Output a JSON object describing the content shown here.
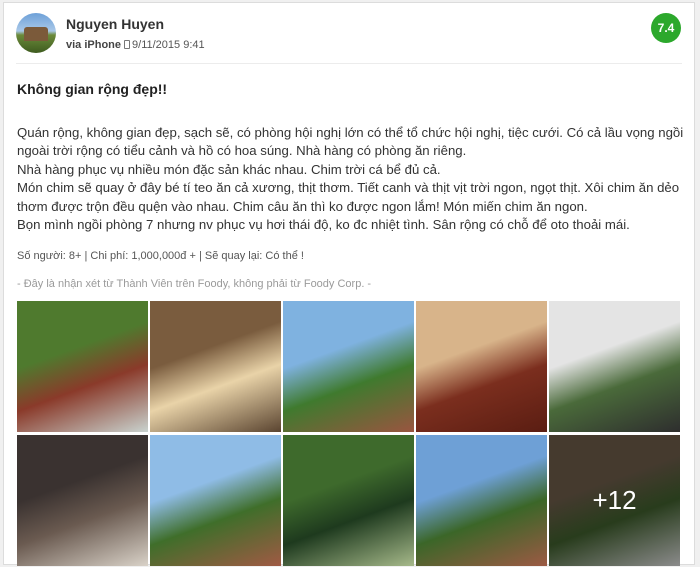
{
  "review": {
    "author": "Nguyen Huyen",
    "via_label": "via iPhone",
    "datetime": "9/11/2015 9:41",
    "score": "7.4",
    "score_color": "#2ca82c",
    "title": "Không gian rộng đẹp!!",
    "body": [
      "Quán rộng, không gian đẹp, sạch sẽ, có phòng hội nghị lớn có thể tổ chức hội nghị, tiệc cưới. Có cả lầu vọng ngồi ngoài trời rộng có tiểu cảnh và hồ có hoa súng. Nhà hàng có phòng ăn riêng.",
      "Nhà hàng phục vụ nhiều món đặc sản khác nhau. Chim trời cá bể đủ cả.",
      "Món chim sẽ quay ở đây bé tí teo ăn cả xương, thịt thơm. Tiết canh và thịt vịt trời ngon, ngọt thịt. Xôi chim ăn dẻo thơm được trộn đều quện vào nhau. Chim câu ăn thì ko được ngon lắm! Món miến chim ăn ngon.",
      "Bọn mình ngồi phòng 7 nhưng nv phục vụ hơi thái độ, ko đc nhiệt tình. Sân rộng có chỗ để oto thoải mái."
    ],
    "stats": "Số người: 8+ | Chi phí: 1,000,000đ + | Sẽ quay lại: Có thể !",
    "disclaimer": "- Đây là nhận xét từ Thành Viên trên Foody, không phải từ Foody Corp. -"
  },
  "gallery": {
    "more_label": "+12",
    "photos": [
      {
        "name": "photo-tree-rooftop",
        "colors": [
          "#4f7a2e",
          "#8a3a2a",
          "#c9d3cf"
        ]
      },
      {
        "name": "photo-ceiling-lamp",
        "colors": [
          "#7a5c3e",
          "#e9d3a8",
          "#5a4430"
        ]
      },
      {
        "name": "photo-courtyard-person",
        "colors": [
          "#7fb2e0",
          "#3f7a2e",
          "#9a5540"
        ]
      },
      {
        "name": "photo-wooden-furniture",
        "colors": [
          "#d8b48a",
          "#7b2e1e",
          "#5a1d12"
        ]
      },
      {
        "name": "photo-staircase",
        "colors": [
          "#e4e4e4",
          "#4a6a3a",
          "#2e2e2e"
        ]
      },
      {
        "name": "photo-hallway",
        "colors": [
          "#3a3230",
          "#6a5a50",
          "#d9d2c8"
        ]
      },
      {
        "name": "photo-garden-walkway",
        "colors": [
          "#8fbce6",
          "#3f6e2a",
          "#a05a44"
        ]
      },
      {
        "name": "photo-lotus-pond",
        "colors": [
          "#3e6a2c",
          "#1e3a1e",
          "#a6b98a"
        ]
      },
      {
        "name": "photo-pavilion",
        "colors": [
          "#6ea0d6",
          "#3b6628",
          "#9c5a44"
        ]
      },
      {
        "name": "photo-street-more",
        "colors": [
          "#6a5a48",
          "#3e5c2c",
          "#d6d6d6"
        ]
      }
    ]
  }
}
